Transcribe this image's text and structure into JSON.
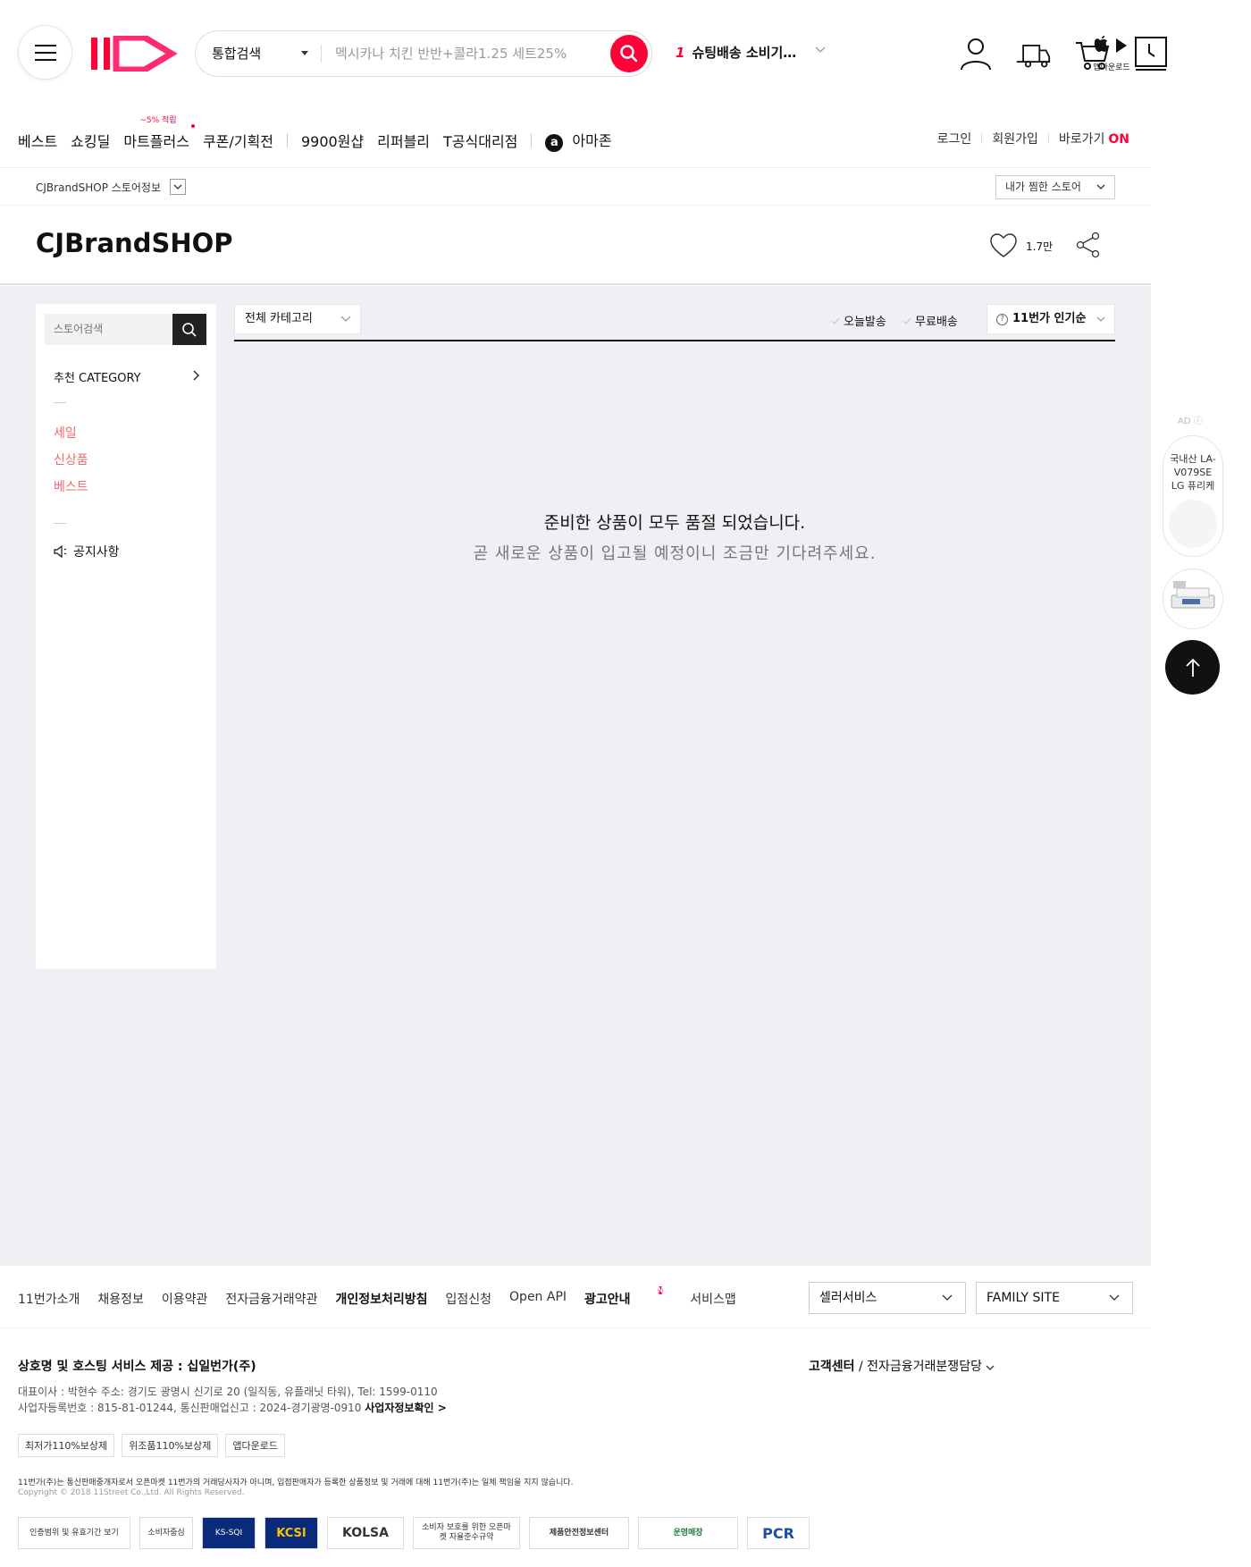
{
  "header": {
    "search_category": "통합검색",
    "search_placeholder": "멕시카나 치킨 반반+콜라1.25 세트25%",
    "rank_number": "1",
    "rank_text": "슈팅배송 소비기…",
    "app_download_label": "앱다운로드",
    "brand_color": "#ff0038"
  },
  "nav": {
    "items": [
      "베스트",
      "쇼킹딜",
      "마트플러스",
      "쿠폰/기획전",
      "9900원샵",
      "리퍼블리",
      "T공식대리점",
      "아마존"
    ],
    "mart_badge": "~5% 적립",
    "login": "로그인",
    "signup": "회원가입",
    "shortcut": "바로가기",
    "shortcut_on": "ON"
  },
  "storebar": {
    "store_info": "CJBrandSHOP 스토어정보",
    "fav_stores": "내가 찜한 스토어"
  },
  "store": {
    "name": "CJBrandSHOP",
    "likes": "1.7만"
  },
  "sidebar": {
    "search_placeholder": "스토어검색",
    "category_title": "추천 CATEGORY",
    "links": [
      "세일",
      "신상품",
      "베스트"
    ],
    "notice": "공지사항"
  },
  "content": {
    "category_select": "전체 카테고리",
    "filter_today": "오늘발송",
    "filter_free": "무료배송",
    "sort": "11번가 인기순",
    "empty_title": "준비한 상품이 모두 품절 되었습니다.",
    "empty_sub": "곧 새로운 상품이 입고될 예정이니 조금만 기다려주세요."
  },
  "floating": {
    "ad_label": "AD",
    "ad_text_1": "국내산 LA-",
    "ad_text_2": "V079SE",
    "ad_text_3": "LG 퓨리케"
  },
  "footer": {
    "links": [
      "11번가소개",
      "채용정보",
      "이용약관",
      "전자금융거래약관",
      "개인정보처리방침",
      "입점신청",
      "Open API",
      "광고안내",
      "서비스맵"
    ],
    "n_badge": "N",
    "seller_service": "셀러서비스",
    "family_site": "FAMILY SITE",
    "company": "상호명 및 호스팅 서비스 제공 : 십일번가(주)",
    "cs_center": "고객센터",
    "cs_sub": " / 전자금융거래분쟁담당",
    "info_line1": "대표이사 : 박현수 주소: 경기도 광명시 신기로 20 (일직동, 유플래닛 타워), Tel: 1599-0110",
    "info_line2": "사업자등록번호 : 815-81-01244, 통신판매업신고 : 2024-경기광명-0910 ",
    "info_link": "사업자정보확인 >",
    "tags": [
      "최저가110%보상제",
      "위조품110%보상제",
      "앱다운로드"
    ],
    "disclaimer": "11번가(주)는 통신판매중개자로서 오픈마켓 11번가의 거래당사자가 아니며, 입점판매자가 등록한 상품정보 및 거래에 대해 11번가(주)는 일체 책임을 지지 않습니다.",
    "copyright": "Copyright © 2018 11Street Co.,Ltd. All Rights Reserved.",
    "certs": [
      "인증범위 및 유효기간 보기",
      "소비자중심",
      "KS-SQI",
      "KCSI",
      "KOLSA",
      "소비자 보호를 위한 오픈마켓 자율준수규약",
      "제품안전정보센터",
      "운영매장",
      "PCR"
    ]
  }
}
